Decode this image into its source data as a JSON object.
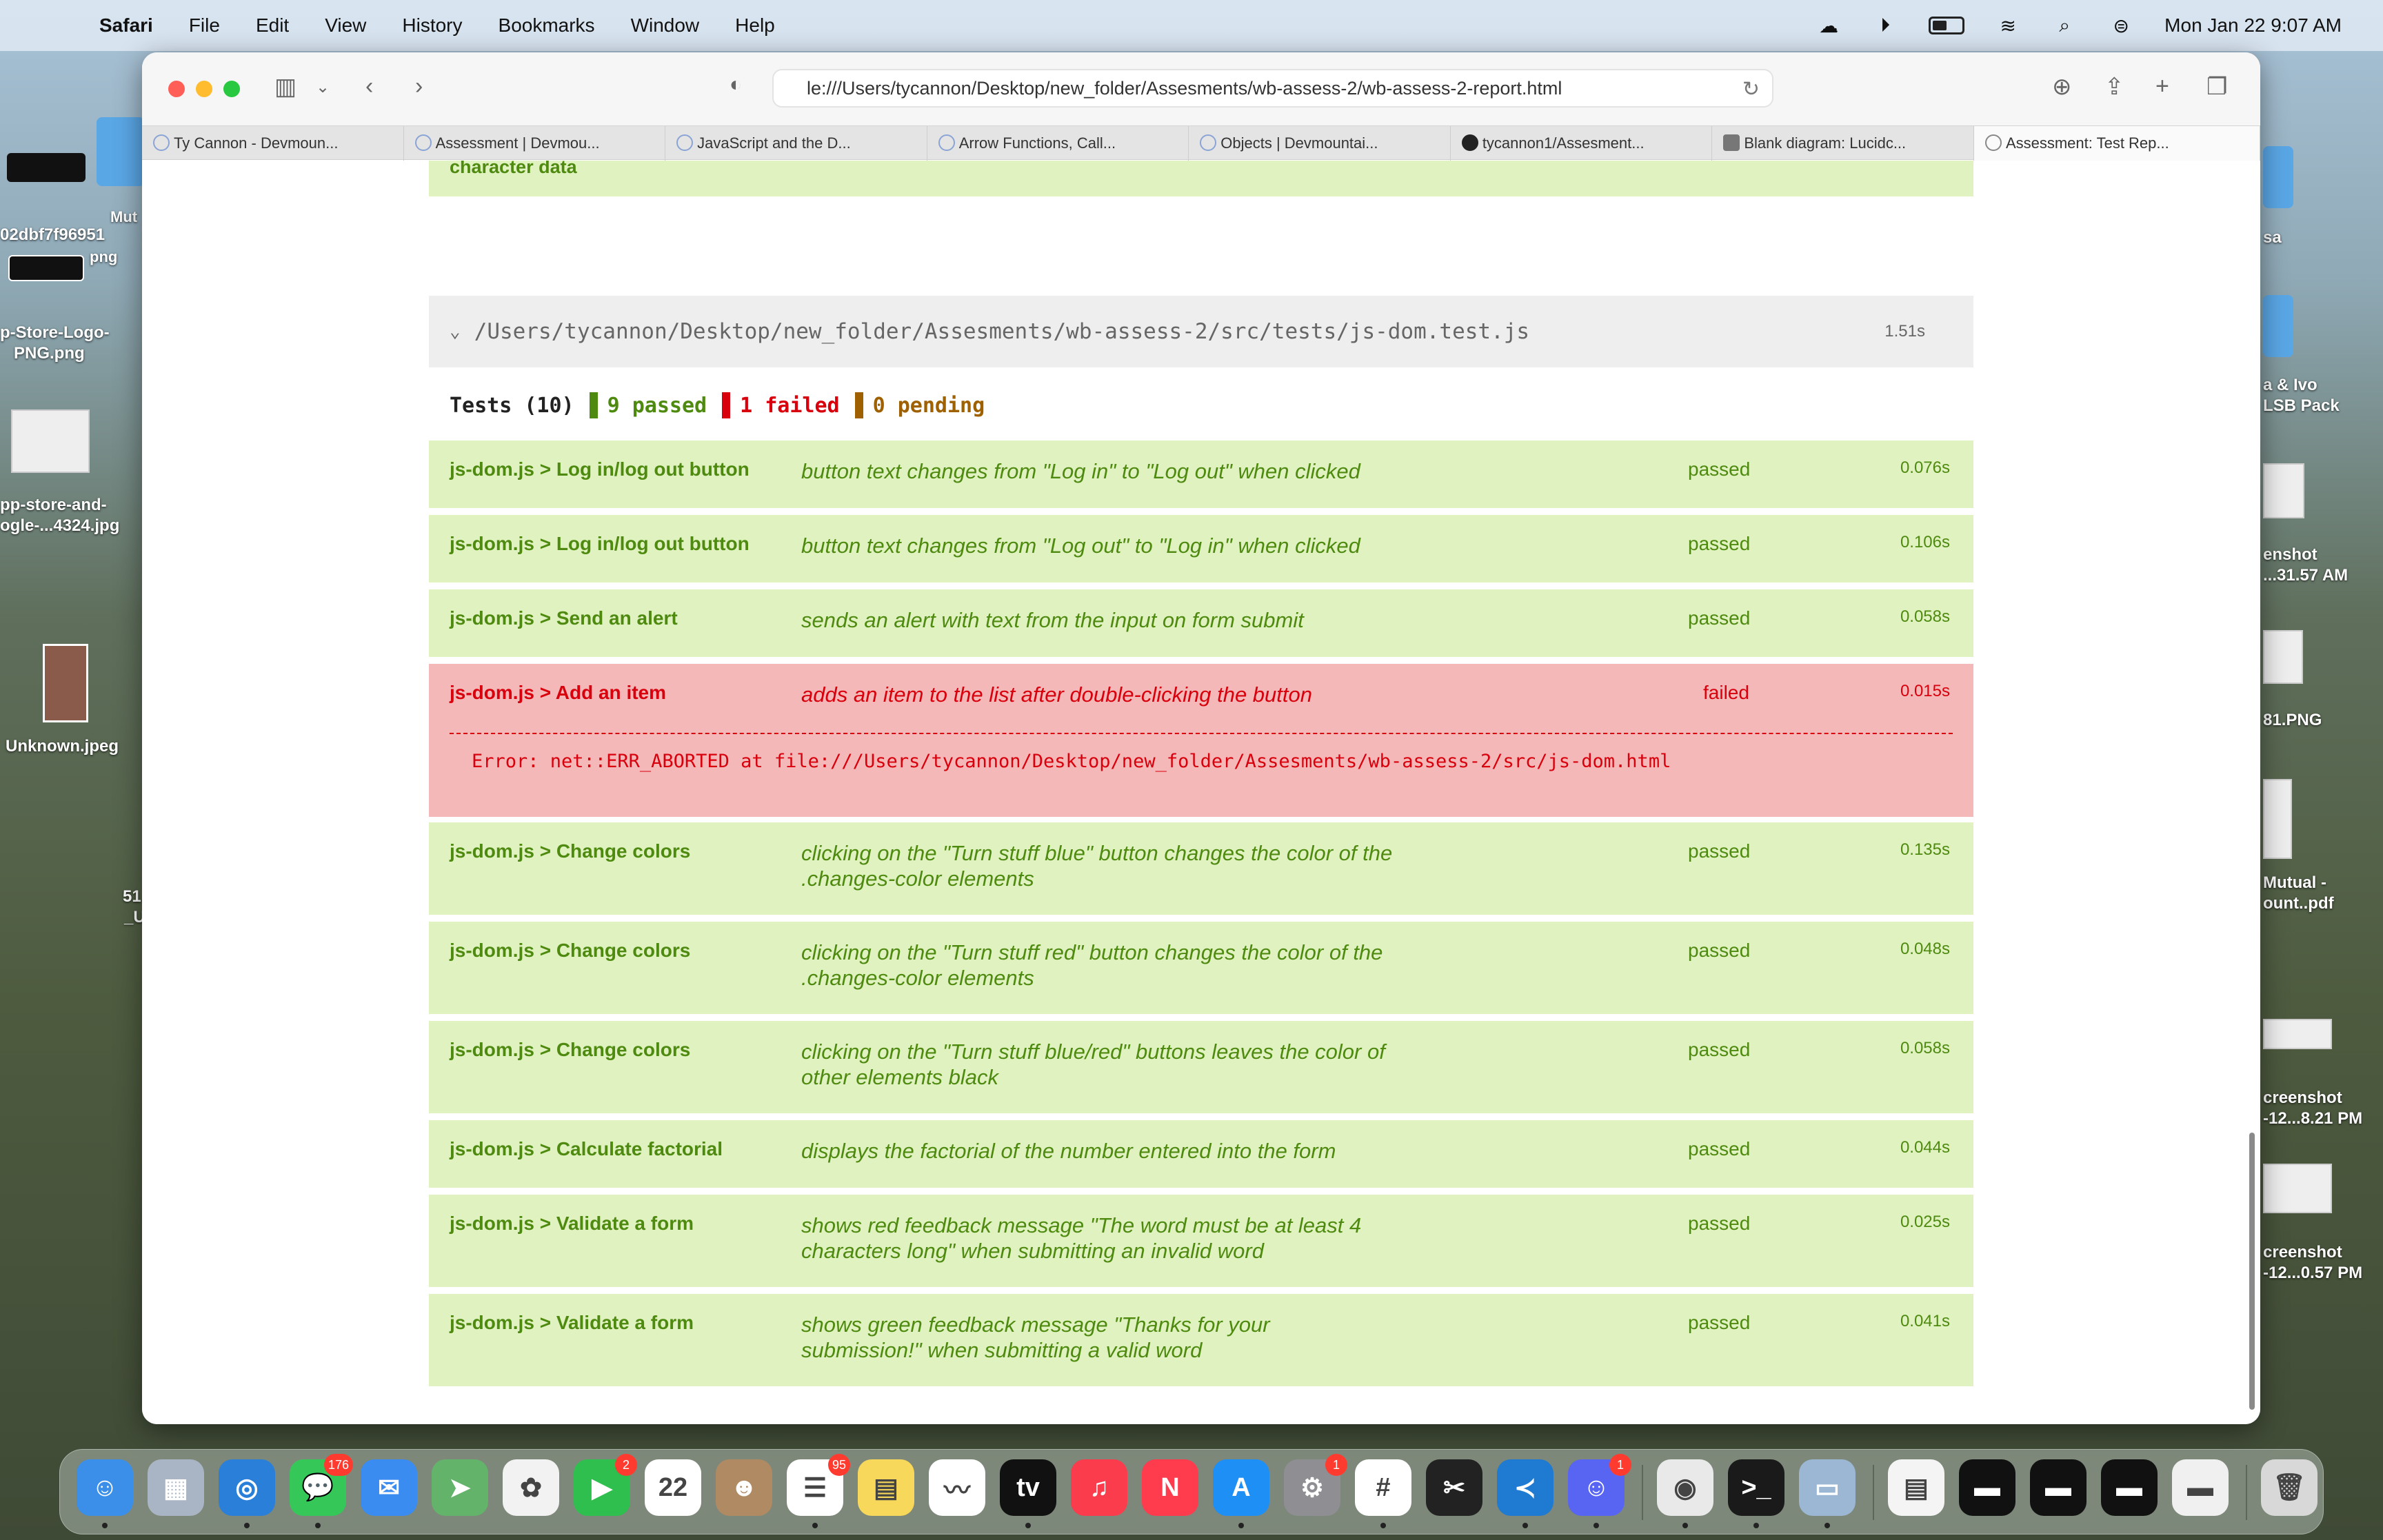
{
  "menubar": {
    "app_name": "Safari",
    "items": [
      "File",
      "Edit",
      "View",
      "History",
      "Bookmarks",
      "Window",
      "Help"
    ],
    "clock": "Mon Jan 22  9:07 AM"
  },
  "desktop": {
    "left": [
      "Mut",
      "02dbf7f96951",
      "png",
      "p-Store-Logo-",
      "PNG.png",
      "pp-store-and-",
      "ogle-...4324.jpg",
      "Unknown.jpeg",
      "51",
      "_U"
    ],
    "right": [
      "sa",
      "a & Ivo",
      "LSB Pack",
      "enshot",
      "...31.57 AM",
      "81.PNG",
      "Mutual -",
      "ount..pdf",
      "creenshot",
      "-12...8.21 PM",
      "creenshot",
      "-12...0.57 PM"
    ]
  },
  "browser": {
    "url": "le:///Users/tycannon/Desktop/new_folder/Assesments/wb-assess-2/wb-assess-2-report.html",
    "tabs": [
      {
        "label": "Ty Cannon - Devmoun..."
      },
      {
        "label": "Assessment | Devmou..."
      },
      {
        "label": "JavaScript and the D..."
      },
      {
        "label": "Arrow Functions, Call..."
      },
      {
        "label": "Objects | Devmountai..."
      },
      {
        "label": "tycannon1/Assesment..."
      },
      {
        "label": "Blank diagram: Lucidc..."
      },
      {
        "label": "Assessment: Test Rep..."
      }
    ]
  },
  "report": {
    "prev_remnant": "character data",
    "suite_path": "/Users/tycannon/Desktop/new_folder/Assesments/wb-assess-2/src/tests/js-dom.test.js",
    "suite_time": "1.51s",
    "summary": {
      "tests_label": "Tests (10)",
      "passed": "9 passed",
      "failed": "1 failed",
      "pending": "0 pending"
    },
    "tests": [
      {
        "suite": "js-dom.js > Log in/log out button",
        "title": "button text changes from \"Log in\" to \"Log out\" when clicked",
        "status": "passed",
        "duration": "0.076s"
      },
      {
        "suite": "js-dom.js > Log in/log out button",
        "title": "button text changes from \"Log out\" to \"Log in\" when clicked",
        "status": "passed",
        "duration": "0.106s"
      },
      {
        "suite": "js-dom.js > Send an alert",
        "title": "sends an alert with text from the input on form submit",
        "status": "passed",
        "duration": "0.058s"
      },
      {
        "suite": "js-dom.js > Add an item",
        "title": "adds an item to the list after double-clicking the button",
        "status": "failed",
        "duration": "0.015s",
        "error": "Error: net::ERR_ABORTED at file:///Users/tycannon/Desktop/new_folder/Assesments/wb-assess-2/src/js-dom.html"
      },
      {
        "suite": "js-dom.js > Change colors",
        "title": "clicking on the \"Turn stuff blue\" button changes the color of the .changes-color elements",
        "status": "passed",
        "duration": "0.135s"
      },
      {
        "suite": "js-dom.js > Change colors",
        "title": "clicking on the \"Turn stuff red\" button changes the color of the .changes-color elements",
        "status": "passed",
        "duration": "0.048s"
      },
      {
        "suite": "js-dom.js > Change colors",
        "title": "clicking on the \"Turn stuff blue/red\" buttons leaves the color of other elements black",
        "status": "passed",
        "duration": "0.058s"
      },
      {
        "suite": "js-dom.js > Calculate factorial",
        "title": "displays the factorial of the number entered into the form",
        "status": "passed",
        "duration": "0.044s"
      },
      {
        "suite": "js-dom.js > Validate a form",
        "title": "shows red feedback message \"The word must be at least 4 characters long\" when submitting an invalid word",
        "status": "passed",
        "duration": "0.025s"
      },
      {
        "suite": "js-dom.js > Validate a form",
        "title": "shows green feedback message \"Thanks for your submission!\" when submitting a valid word",
        "status": "passed",
        "duration": "0.041s"
      }
    ]
  },
  "dock": {
    "apps": [
      {
        "name": "finder-icon",
        "color": "#3b8fe8",
        "glyph": "☺"
      },
      {
        "name": "launchpad-icon",
        "color": "#a9b4c4",
        "glyph": "▦"
      },
      {
        "name": "safari-icon",
        "color": "#2a7fd9",
        "glyph": "◎"
      },
      {
        "name": "messages-icon",
        "color": "#36c759",
        "glyph": "💬",
        "badge": "176"
      },
      {
        "name": "mail-icon",
        "color": "#3a8cf0",
        "glyph": "✉"
      },
      {
        "name": "maps-icon",
        "color": "#63b46a",
        "glyph": "➤"
      },
      {
        "name": "photos-icon",
        "color": "#f2f2f2",
        "glyph": "✿"
      },
      {
        "name": "facetime-icon",
        "color": "#2fbf4f",
        "glyph": "▶",
        "badge": "2"
      },
      {
        "name": "calendar-icon",
        "color": "#ffffff",
        "glyph": "22"
      },
      {
        "name": "contacts-icon",
        "color": "#b08a62",
        "glyph": "☻"
      },
      {
        "name": "reminders-icon",
        "color": "#ffffff",
        "glyph": "☰",
        "badge": "95"
      },
      {
        "name": "notes-icon",
        "color": "#f7d85a",
        "glyph": "▤"
      },
      {
        "name": "freeform-icon",
        "color": "#ffffff",
        "glyph": "〰"
      },
      {
        "name": "appletv-icon",
        "color": "#111111",
        "glyph": "tv"
      },
      {
        "name": "music-icon",
        "color": "#fa3c4c",
        "glyph": "♫"
      },
      {
        "name": "news-icon",
        "color": "#ff3b4e",
        "glyph": "N"
      },
      {
        "name": "appstore-icon",
        "color": "#1e8ff5",
        "glyph": "A"
      },
      {
        "name": "system-settings-icon",
        "color": "#8e8e93",
        "glyph": "⚙",
        "badge": "1"
      },
      {
        "name": "slack-icon",
        "color": "#ffffff",
        "glyph": "#"
      },
      {
        "name": "final-cut-icon",
        "color": "#222222",
        "glyph": "✂"
      },
      {
        "name": "vscode-icon",
        "color": "#1f7ad1",
        "glyph": "≺"
      },
      {
        "name": "discord-icon",
        "color": "#5865f2",
        "glyph": "☺",
        "badge": "1"
      },
      {
        "name": "chrome-icon",
        "color": "#e9e9e9",
        "glyph": "◉"
      },
      {
        "name": "terminal-icon",
        "color": "#1a1a1a",
        "glyph": ">_"
      },
      {
        "name": "preview-icon",
        "color": "#9bb7d4",
        "glyph": "▭"
      },
      {
        "name": "recent-doc-icon",
        "color": "#f4f4f4",
        "glyph": "▤"
      },
      {
        "name": "recent-window-1-icon",
        "color": "#111111",
        "glyph": "▬"
      },
      {
        "name": "recent-window-2-icon",
        "color": "#111111",
        "glyph": "▬"
      },
      {
        "name": "recent-window-3-icon",
        "color": "#111111",
        "glyph": "▬"
      },
      {
        "name": "recent-window-4-icon",
        "color": "#f0f0f0",
        "glyph": "▬"
      },
      {
        "name": "trash-icon",
        "color": "#d8d8d8",
        "glyph": "🗑"
      }
    ]
  }
}
